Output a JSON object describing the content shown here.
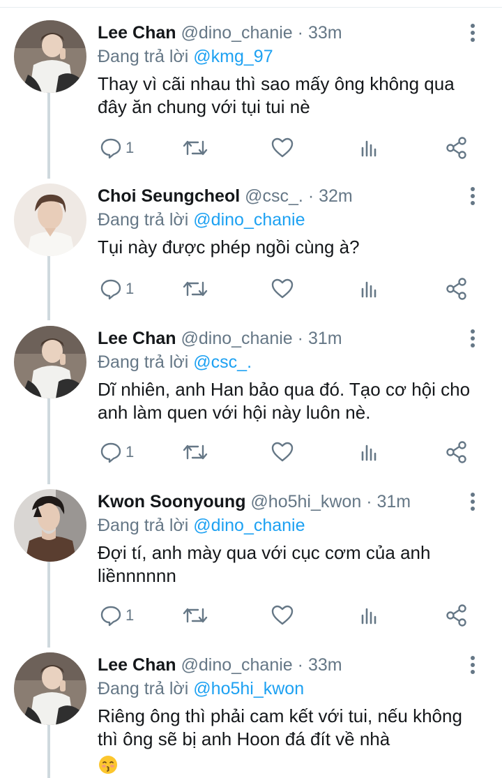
{
  "tweets": [
    {
      "name": "Lee Chan",
      "handle": "@dino_chanie",
      "dot": "·",
      "time": "33m",
      "reply_prefix": "Đang trả lời",
      "reply_to": "@kmg_97",
      "text": "Thay vì cãi nhau thì sao mấy ông không qua đây ăn chung với tụi tui nè",
      "reply_count": "1",
      "avatar": "lee-chan-avatar"
    },
    {
      "name": "Choi Seungcheol",
      "handle": "@csc_.",
      "dot": "·",
      "time": "32m",
      "reply_prefix": "Đang trả lời",
      "reply_to": "@dino_chanie",
      "text": "Tụi này được phép ngồi cùng à?",
      "reply_count": "1",
      "avatar": "choi-seungcheol-avatar"
    },
    {
      "name": "Lee Chan",
      "handle": "@dino_chanie",
      "dot": "·",
      "time": "31m",
      "reply_prefix": "Đang trả lời",
      "reply_to": "@csc_.",
      "text": "Dĩ nhiên, anh Han bảo qua đó. Tạo cơ hội cho anh làm quen với hội này luôn nè.",
      "reply_count": "1",
      "avatar": "lee-chan-avatar"
    },
    {
      "name": "Kwon Soonyoung",
      "handle": "@ho5hi_kwon",
      "dot": "·",
      "time": "31m",
      "reply_prefix": "Đang trả lời",
      "reply_to": "@dino_chanie",
      "text": "Đợi tí, anh mày qua với cục cơm của anh liềnnnnnn",
      "reply_count": "1",
      "avatar": "kwon-soonyoung-avatar"
    },
    {
      "name": "Lee Chan",
      "handle": "@dino_chanie",
      "dot": "·",
      "time": "33m",
      "reply_prefix": "Đang trả lời",
      "reply_to": "@ho5hi_kwon",
      "text": "Riêng ông thì phải cam kết với tui, nếu không thì ông sẽ bị anh Hoon đá đít về nhà",
      "trailing_emoji": "kissing-face-emoji",
      "avatar": "lee-chan-avatar"
    }
  ],
  "icons": {
    "reply": "comment-icon",
    "retweet": "retweet-icon",
    "like": "heart-icon",
    "analytics": "analytics-icon",
    "share": "share-icon",
    "more": "more-vertical-icon"
  },
  "colors": {
    "text": "#14171a",
    "secondary": "#657786",
    "mention": "#1da1f2",
    "divider": "#e6ecf0",
    "thread_line": "#cfd9de"
  }
}
